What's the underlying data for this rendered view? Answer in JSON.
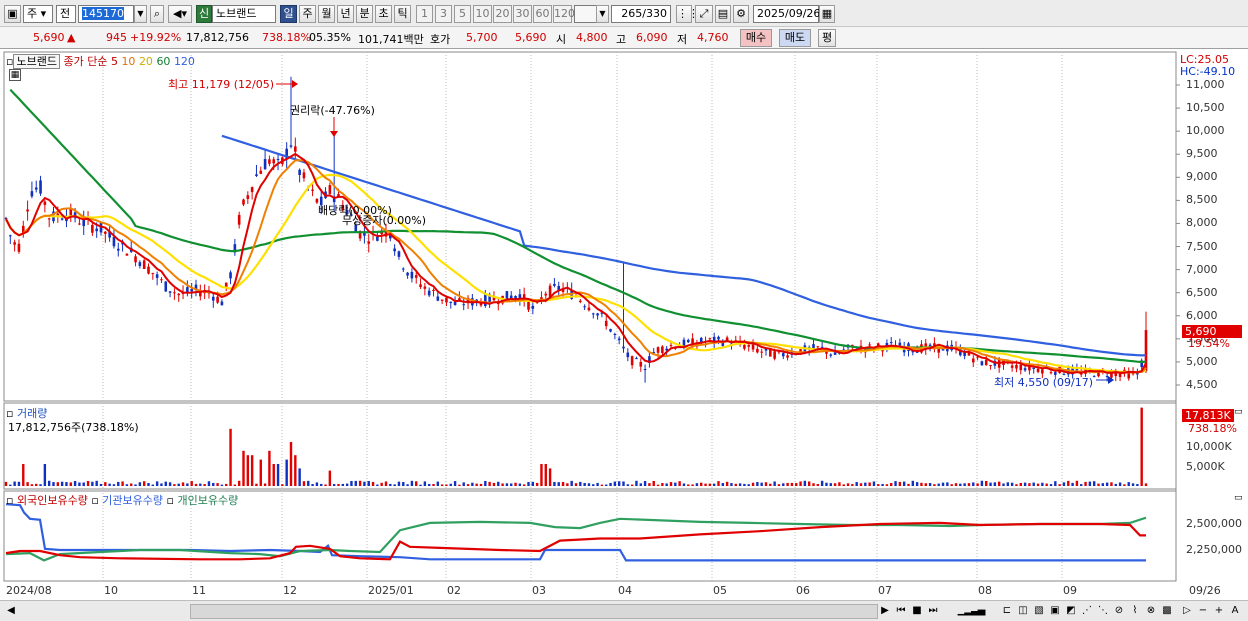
{
  "toolbar": {
    "market": "주",
    "prev": "전",
    "code": "145170",
    "sin": "신",
    "name": "노브랜드",
    "periods": [
      "일",
      "주",
      "월",
      "년",
      "분",
      "초",
      "틱"
    ],
    "intervals": [
      "1",
      "3",
      "5",
      "10",
      "20",
      "30",
      "60",
      "120"
    ],
    "count": "265",
    "total": "/330",
    "date": "2025/09/26"
  },
  "quote": {
    "price": "5,690",
    "change_arrow": "▲",
    "change": "945",
    "change_pct": "+19.92%",
    "volume": "17,812,756",
    "volume_pct": "738.18%",
    "turnover": "05.35%",
    "amount": "101,741백만",
    "hoga_label": "호가",
    "ask": "5,700",
    "bid": "5,690",
    "open_label": "시",
    "open": "4,800",
    "high_label": "고",
    "high": "6,090",
    "low_label": "저",
    "low": "4,760",
    "buy": "매수",
    "sell": "매도",
    "eval": "평"
  },
  "price_panel": {
    "stock_tag": "노브랜드",
    "ma_title": "종가 단순",
    "ma_periods": [
      "5",
      "10",
      "20",
      "60",
      "120"
    ],
    "high_note": "최고 11,179 (12/05)",
    "rights_note": "권리락(-47.76%)",
    "note_a": "배당락(0.00%)",
    "note_b": "무상증자(0.00%)",
    "low_note": "최저 4,550 (09/17)",
    "lc": "LC:25.05",
    "hc": "HC:-49.10",
    "price_tag": "5,690",
    "pct_tag": "19.54%",
    "y_labels": [
      "11,000",
      "10,500",
      "10,000",
      "9,500",
      "9,000",
      "8,500",
      "8,000",
      "7,500",
      "7,000",
      "6,500",
      "6,000",
      "5,500",
      "5,000",
      "4,500"
    ]
  },
  "volume_panel": {
    "title": "거래량",
    "info": "17,812,756주(738.18%)",
    "tag_volume": "17,813K",
    "tag_pct": "738.18%",
    "y_labels": [
      "10,000K",
      "5,000K"
    ]
  },
  "holdings_panel": {
    "legend": [
      "외국인보유수량",
      "기관보유수량",
      "개인보유수량"
    ],
    "y_labels": [
      "2,500,000",
      "2,250,000"
    ]
  },
  "x_axis": {
    "labels": [
      "2024/08",
      "10",
      "11",
      "12",
      "2025/01",
      "02",
      "03",
      "04",
      "05",
      "06",
      "07",
      "08",
      "09",
      "09/26"
    ]
  },
  "colors": {
    "candle_up": "#e00000",
    "candle_down": "#1030c0",
    "ma5": "#e00000",
    "ma10": "#f08000",
    "ma20": "#ffe000",
    "ma60": "#109030",
    "ma120": "#3060e0",
    "foreign": "#e00000",
    "institution": "#3060e0",
    "individual": "#30a060"
  }
}
